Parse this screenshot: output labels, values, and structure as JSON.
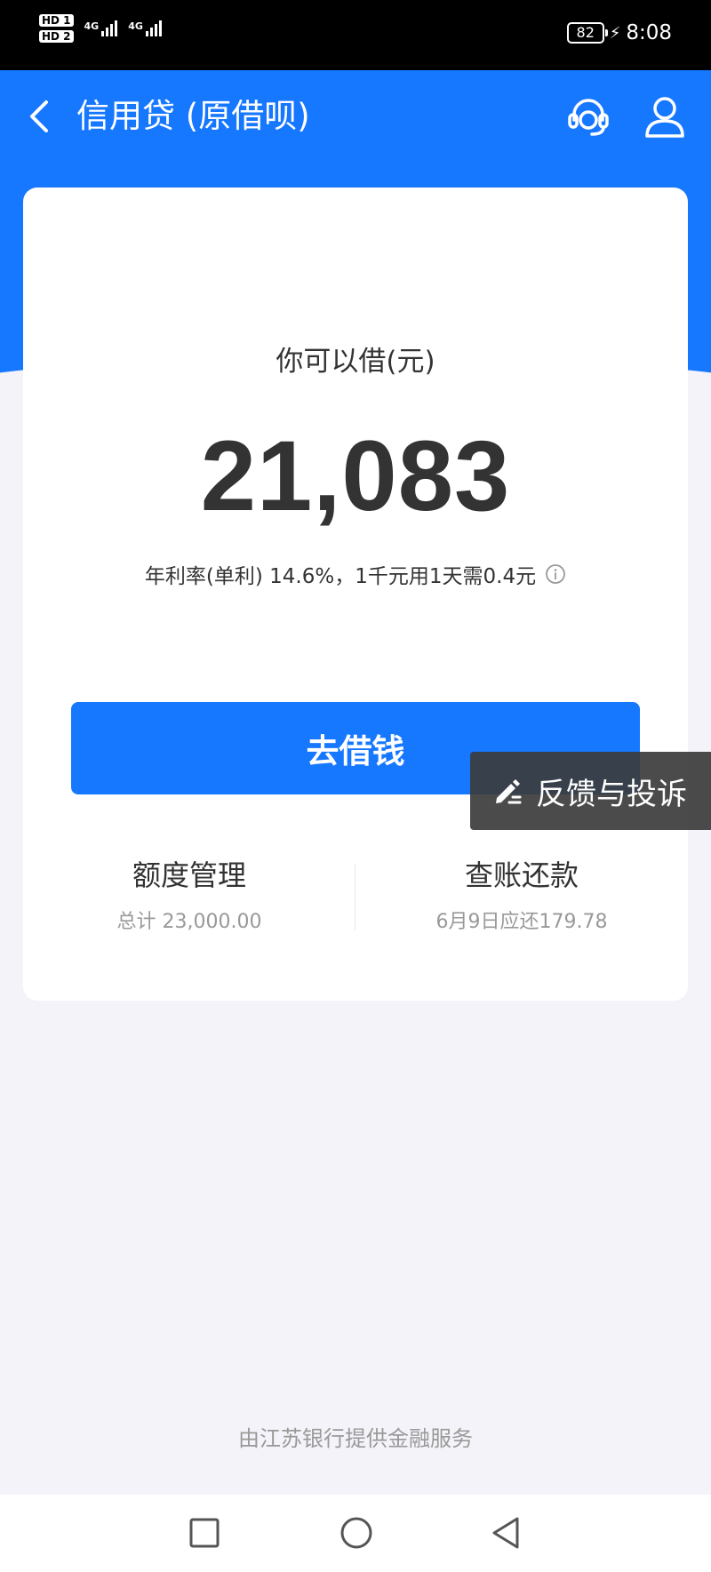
{
  "status_bar": {
    "sim1": "HD 1",
    "sim2": "HD 2",
    "network1": "4G",
    "network2": "4G",
    "battery": "82",
    "time": "8:08"
  },
  "header": {
    "title": "信用贷 (原借呗)",
    "back_icon": "chevron-left-icon",
    "support_icon": "headset-icon",
    "user_icon": "user-icon"
  },
  "card": {
    "amount_label": "你可以借(元)",
    "amount": "21,083",
    "rate_text": "年利率(单利) 14.6%，1千元用1天需0.4元",
    "borrow_button": "去借钱",
    "limit": {
      "title": "额度管理",
      "sub": "总计 23,000.00"
    },
    "repay": {
      "title": "查账还款",
      "sub": "6月9日应还179.78"
    }
  },
  "feedback": {
    "label": "反馈与投诉"
  },
  "footer": {
    "provider": "由江苏银行提供金融服务"
  },
  "colors": {
    "brand": "#1677ff",
    "background": "#f4f3f9",
    "text_primary": "#333333",
    "text_secondary": "#999999"
  }
}
